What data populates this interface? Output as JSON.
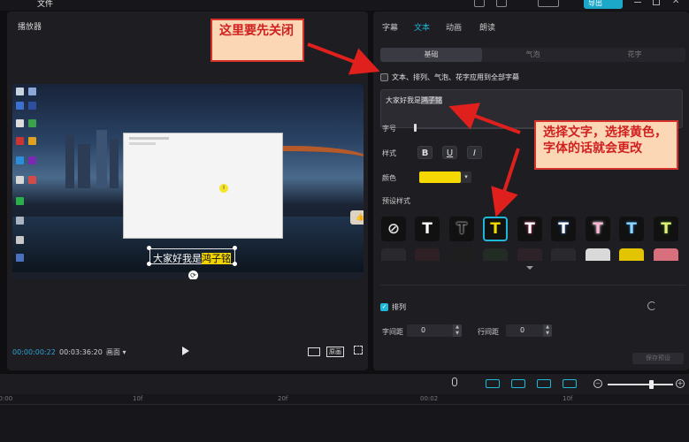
{
  "topbar": {
    "file_menu": "文件",
    "export_label": "导出",
    "close_glyph": "✕"
  },
  "player": {
    "title": "播放器",
    "subtitle_plain": "大家好我是",
    "subtitle_highlight": "鸿子铭",
    "timecode_current": "00:00:00:22",
    "timecode_total": "00:03:36:20",
    "ratio_label": "画面 ▾",
    "original_label": "原画"
  },
  "inspector": {
    "tabs": [
      {
        "label": "字幕"
      },
      {
        "label": "文本"
      },
      {
        "label": "动画"
      },
      {
        "label": "朗读"
      }
    ],
    "active_tab": "文本",
    "segments": [
      {
        "label": "基础"
      },
      {
        "label": "气泡"
      },
      {
        "label": "花字"
      }
    ],
    "apply_all_label": "文本、排列、气泡、花字应用到全部字幕",
    "text_value_plain": "大家好我是",
    "text_value_selected": "鸿子铭",
    "size_label": "字号",
    "style_label": "样式",
    "style_buttons": [
      "B",
      "U",
      "I"
    ],
    "color_label": "颜色",
    "color_value": "#f5d800",
    "preset_label": "预设样式",
    "presets": [
      {
        "glyph": "⊘",
        "color": "#dddddd"
      },
      {
        "glyph": "T",
        "color": "#ffffff"
      },
      {
        "glyph": "T",
        "color": "#1a1a1a"
      },
      {
        "glyph": "T",
        "color": "#f5d800"
      },
      {
        "glyph": "T",
        "color": "#ffffff"
      },
      {
        "glyph": "T",
        "color": "#ffffff"
      },
      {
        "glyph": "T",
        "color": "#ffb6d5"
      },
      {
        "glyph": "T",
        "color": "#8fd8ff"
      },
      {
        "glyph": "T",
        "color": "#e8f07a"
      }
    ],
    "arrange_label": "排列",
    "letter_spacing_label": "字间距",
    "letter_spacing_value": "0",
    "line_spacing_label": "行间距",
    "line_spacing_value": "0",
    "save_preset_label": "保存预设"
  },
  "timeline": {
    "ticks": [
      "00:00",
      "10f",
      "20f",
      "00:02",
      "10f",
      "20f"
    ]
  },
  "annotations": {
    "callout_1": "这里要先关闭",
    "callout_2": "选择文字，选择黄色，字体的话就会更改",
    "accent_color": "#d6322c"
  }
}
